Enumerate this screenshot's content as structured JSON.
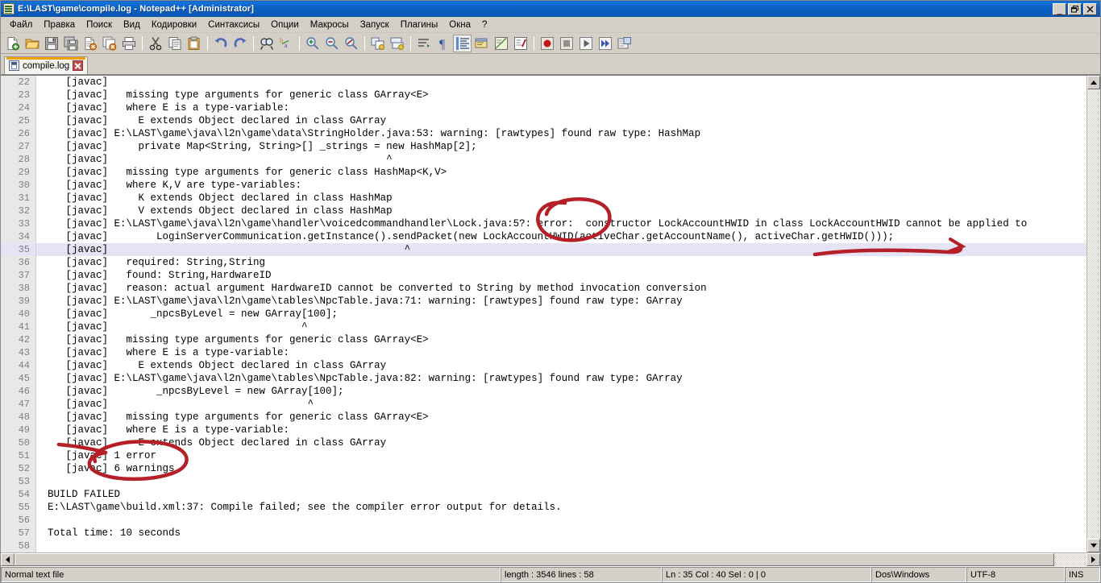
{
  "window": {
    "title": "E:\\LAST\\game\\compile.log - Notepad++ [Administrator]",
    "icon": "notepad-plus-plus-icon",
    "minimize_label": "_",
    "maximize_label": "❐",
    "close_label": "×"
  },
  "menu": {
    "items": [
      {
        "label": "Файл"
      },
      {
        "label": "Правка"
      },
      {
        "label": "Поиск"
      },
      {
        "label": "Вид"
      },
      {
        "label": "Кодировки"
      },
      {
        "label": "Синтаксисы"
      },
      {
        "label": "Опции"
      },
      {
        "label": "Макросы"
      },
      {
        "label": "Запуск"
      },
      {
        "label": "Плагины"
      },
      {
        "label": "Окна"
      },
      {
        "label": "?"
      }
    ]
  },
  "toolbar": {
    "buttons": [
      {
        "name": "new-file-icon"
      },
      {
        "name": "open-file-icon"
      },
      {
        "name": "save-icon"
      },
      {
        "name": "save-all-icon"
      },
      {
        "name": "close-file-icon"
      },
      {
        "name": "close-all-icon"
      },
      {
        "name": "print-icon"
      },
      {
        "name": "separator"
      },
      {
        "name": "cut-icon"
      },
      {
        "name": "copy-icon"
      },
      {
        "name": "paste-icon"
      },
      {
        "name": "separator"
      },
      {
        "name": "undo-icon"
      },
      {
        "name": "redo-icon"
      },
      {
        "name": "separator"
      },
      {
        "name": "find-icon"
      },
      {
        "name": "replace-icon"
      },
      {
        "name": "separator"
      },
      {
        "name": "zoom-in-icon"
      },
      {
        "name": "zoom-out-icon"
      },
      {
        "name": "zoom-restore-icon"
      },
      {
        "name": "separator"
      },
      {
        "name": "sync-vertical-scroll-icon"
      },
      {
        "name": "sync-horizontal-scroll-icon"
      },
      {
        "name": "separator"
      },
      {
        "name": "word-wrap-icon"
      },
      {
        "name": "show-all-chars-icon"
      },
      {
        "name": "indent-guide-icon"
      },
      {
        "name": "user-defined-dialog-icon"
      },
      {
        "name": "document-map-icon"
      },
      {
        "name": "function-list-icon"
      },
      {
        "name": "separator"
      },
      {
        "name": "macro-record-icon"
      },
      {
        "name": "macro-stop-icon"
      },
      {
        "name": "macro-play-icon"
      },
      {
        "name": "macro-playback-multiple-icon"
      },
      {
        "name": "macro-save-icon"
      }
    ]
  },
  "tabs": [
    {
      "label": "compile.log",
      "icon": "saved-document-icon",
      "close": "close-tab-icon",
      "active": true
    }
  ],
  "editor": {
    "first_line": 22,
    "current_line": 35,
    "lines": [
      {
        "n": 22,
        "text": "   [javac]"
      },
      {
        "n": 23,
        "text": "   [javac]   missing type arguments for generic class GArray<E>"
      },
      {
        "n": 24,
        "text": "   [javac]   where E is a type-variable:"
      },
      {
        "n": 25,
        "text": "   [javac]     E extends Object declared in class GArray"
      },
      {
        "n": 26,
        "text": "   [javac] E:\\LAST\\game\\java\\l2n\\game\\data\\StringHolder.java:53: warning: [rawtypes] found raw type: HashMap"
      },
      {
        "n": 27,
        "text": "   [javac]     private Map<String, String>[] _strings = new HashMap[2];"
      },
      {
        "n": 28,
        "text": "   [javac]                                              ^"
      },
      {
        "n": 29,
        "text": "   [javac]   missing type arguments for generic class HashMap<K,V>"
      },
      {
        "n": 30,
        "text": "   [javac]   where K,V are type-variables:"
      },
      {
        "n": 31,
        "text": "   [javac]     K extends Object declared in class HashMap"
      },
      {
        "n": 32,
        "text": "   [javac]     V extends Object declared in class HashMap"
      },
      {
        "n": 33,
        "text": "   [javac] E:\\LAST\\game\\java\\l2n\\game\\handler\\voicedcommandhandler\\Lock.java:5?: error:  constructor LockAccountHWID in class LockAccountHWID cannot be applied to"
      },
      {
        "n": 34,
        "text": "   [javac]        LoginServerCommunication.getInstance().sendPacket(new LockAccountHWID(activeChar.getAccountName(), activeChar.getHWID()));"
      },
      {
        "n": 35,
        "text": "   [javac]                                                 ^"
      },
      {
        "n": 36,
        "text": "   [javac]   required: String,String"
      },
      {
        "n": 37,
        "text": "   [javac]   found: String,HardwareID"
      },
      {
        "n": 38,
        "text": "   [javac]   reason: actual argument HardwareID cannot be converted to String by method invocation conversion"
      },
      {
        "n": 39,
        "text": "   [javac] E:\\LAST\\game\\java\\l2n\\game\\tables\\NpcTable.java:71: warning: [rawtypes] found raw type: GArray"
      },
      {
        "n": 40,
        "text": "   [javac]       _npcsByLevel = new GArray[100];"
      },
      {
        "n": 41,
        "text": "   [javac]                                ^"
      },
      {
        "n": 42,
        "text": "   [javac]   missing type arguments for generic class GArray<E>"
      },
      {
        "n": 43,
        "text": "   [javac]   where E is a type-variable:"
      },
      {
        "n": 44,
        "text": "   [javac]     E extends Object declared in class GArray"
      },
      {
        "n": 45,
        "text": "   [javac] E:\\LAST\\game\\java\\l2n\\game\\tables\\NpcTable.java:82: warning: [rawtypes] found raw type: GArray"
      },
      {
        "n": 46,
        "text": "   [javac]        _npcsByLevel = new GArray[100];"
      },
      {
        "n": 47,
        "text": "   [javac]                                 ^"
      },
      {
        "n": 48,
        "text": "   [javac]   missing type arguments for generic class GArray<E>"
      },
      {
        "n": 49,
        "text": "   [javac]   where E is a type-variable:"
      },
      {
        "n": 50,
        "text": "   [javac]     E extends Object declared in class GArray"
      },
      {
        "n": 51,
        "text": "   [javac] 1 error"
      },
      {
        "n": 52,
        "text": "   [javac] 6 warnings"
      },
      {
        "n": 53,
        "text": ""
      },
      {
        "n": 54,
        "text": "BUILD FAILED"
      },
      {
        "n": 55,
        "text": "E:\\LAST\\game\\build.xml:37: Compile failed; see the compiler error output for details."
      },
      {
        "n": 56,
        "text": ""
      },
      {
        "n": 57,
        "text": "Total time: 10 seconds"
      },
      {
        "n": 58,
        "text": ""
      }
    ]
  },
  "annotations": {
    "color": "#b51f28",
    "marks": [
      {
        "name": "ellipse-around-error-keyword",
        "shape": "ellipse"
      },
      {
        "name": "underline-arrow-under-gethwid-call",
        "shape": "arrow"
      },
      {
        "name": "ellipse-around-error-warning-summary",
        "shape": "ellipse"
      }
    ]
  },
  "statusbar": {
    "file_type": "Normal text file",
    "length_lines": "length : 3546   lines : 58",
    "caret": "Ln : 35   Col : 40   Sel : 0 | 0",
    "eol": "Dos\\Windows",
    "encoding": "UTF-8",
    "insert_mode": "INS"
  },
  "scrollbars": {
    "vertical_up": "scroll-up-arrow",
    "vertical_down": "scroll-down-arrow",
    "horizontal_left": "scroll-left-arrow",
    "horizontal_right": "scroll-right-arrow"
  }
}
